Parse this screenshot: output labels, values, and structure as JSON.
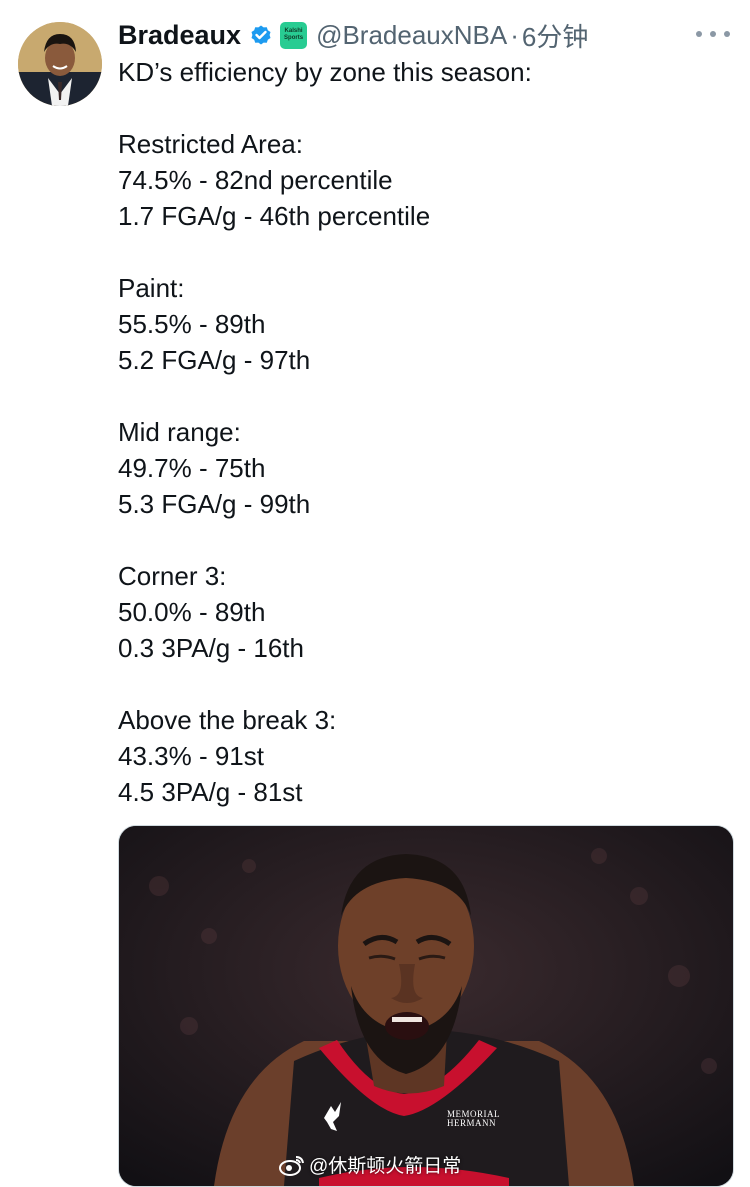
{
  "author": {
    "display_name": "Bradeaux",
    "handle": "@BradeauxNBA",
    "separator": "·",
    "time_ago": "6分钟",
    "org_badge_line1": "Kalshi",
    "org_badge_line2": "Sports"
  },
  "icons": {
    "verified": "verified-badge-icon",
    "more": "more-options-icon",
    "watermark": "weibo-logo-icon"
  },
  "colors": {
    "verified_blue": "#1d9bf0",
    "secondary_text": "#536471",
    "org_badge_green": "#28cc92"
  },
  "tweet": {
    "lines": [
      "KD’s efficiency by zone this season:",
      "",
      "Restricted Area:",
      "74.5% - 82nd percentile",
      "1.7 FGA/g - 46th percentile",
      "",
      "Paint:",
      "55.5% - 89th",
      "5.2 FGA/g - 97th",
      "",
      "Mid range:",
      "49.7% - 75th",
      "5.3 FGA/g - 99th",
      "",
      "Corner 3:",
      "50.0% - 89th",
      "0.3 3PA/g - 16th",
      "",
      "Above the break 3:",
      "43.3% - 91st",
      "4.5 3PA/g - 81st"
    ]
  },
  "media": {
    "watermark_text": "@休斯顿火箭日常",
    "jersey_patch_line1": "MEMORIAL",
    "jersey_patch_line2": "HERMANN"
  }
}
